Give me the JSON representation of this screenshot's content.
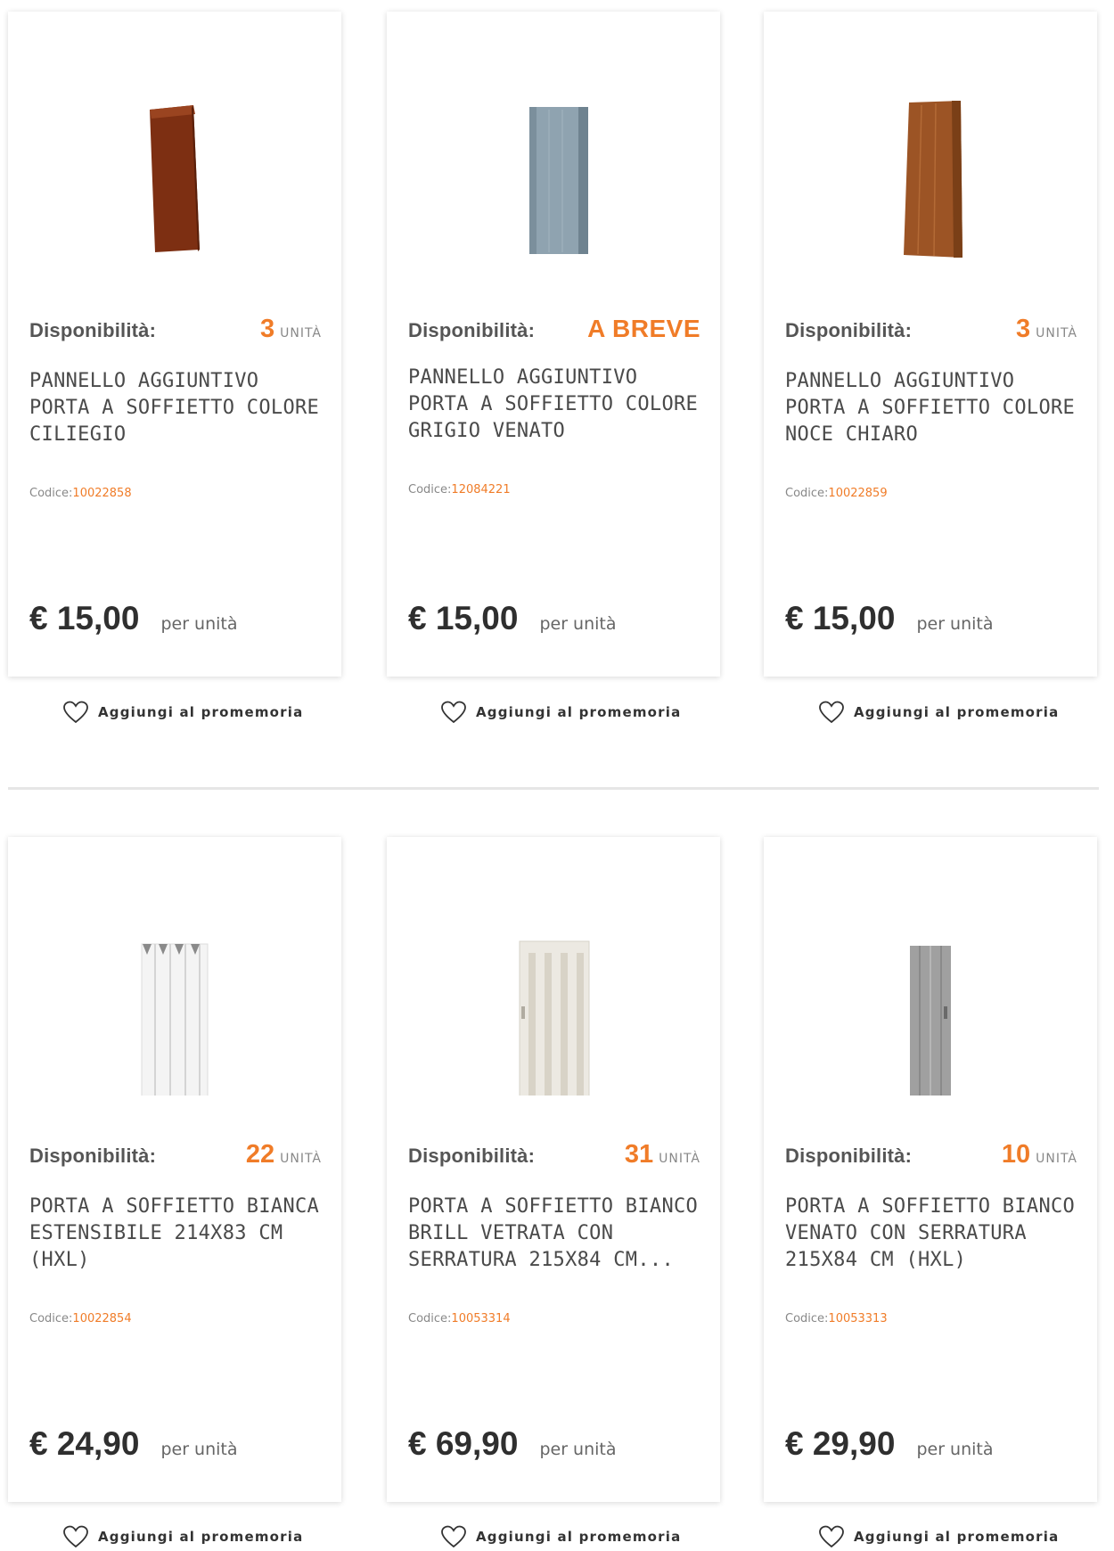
{
  "products": [
    {
      "availability_label": "Disponibilità:",
      "availability_qty": "3",
      "availability_unit": "UNITÀ",
      "title": "PANNELLO AGGIUNTIVO PORTA A SOFFIETTO COLORE CILIEGIO",
      "code_label": "Codice:",
      "code": "10022858",
      "price": "€ 15,00",
      "per_unit": "per unità",
      "reminder": "Aggiungi al promemoria",
      "image_color": "#8b3a1b"
    },
    {
      "availability_label": "Disponibilità:",
      "availability_status": "A BREVE",
      "title": "PANNELLO AGGIUNTIVO PORTA A SOFFIETTO COLORE GRIGIO VENATO",
      "code_label": "Codice:",
      "code": "12084221",
      "price": "€ 15,00",
      "per_unit": "per unità",
      "reminder": "Aggiungi al promemoria",
      "image_color": "#8fa3b0"
    },
    {
      "availability_label": "Disponibilità:",
      "availability_qty": "3",
      "availability_unit": "UNITÀ",
      "title": "PANNELLO AGGIUNTIVO PORTA A SOFFIETTO COLORE NOCE CHIARO",
      "code_label": "Codice:",
      "code": "10022859",
      "price": "€ 15,00",
      "per_unit": "per unità",
      "reminder": "Aggiungi al promemoria",
      "image_color": "#a0582a"
    },
    {
      "availability_label": "Disponibilità:",
      "availability_qty": "22",
      "availability_unit": "UNITÀ",
      "title": "PORTA A SOFFIETTO BIANCA ESTENSIBILE 214X83 CM (HXL)",
      "code_label": "Codice:",
      "code": "10022854",
      "price": "€ 24,90",
      "per_unit": "per unità",
      "reminder": "Aggiungi al promemoria",
      "image_color": "#f2f2f2"
    },
    {
      "availability_label": "Disponibilità:",
      "availability_qty": "31",
      "availability_unit": "UNITÀ",
      "title": "PORTA A SOFFIETTO BIANCO BRILL VETRATA CON SERRATURA 215X84 CM...",
      "code_label": "Codice:",
      "code": "10053314",
      "price": "€ 69,90",
      "per_unit": "per unità",
      "reminder": "Aggiungi al promemoria",
      "image_color": "#ece9e2"
    },
    {
      "availability_label": "Disponibilità:",
      "availability_qty": "10",
      "availability_unit": "UNITÀ",
      "title": "PORTA A SOFFIETTO BIANCO VENATO CON SERRATURA 215X84 CM (HXL)",
      "code_label": "Codice:",
      "code": "10053313",
      "price": "€ 29,90",
      "per_unit": "per unità",
      "reminder": "Aggiungi al promemoria",
      "image_color": "#9a9a9a"
    }
  ],
  "colors": {
    "accent": "#f07c28",
    "text": "#3a3a3a"
  }
}
